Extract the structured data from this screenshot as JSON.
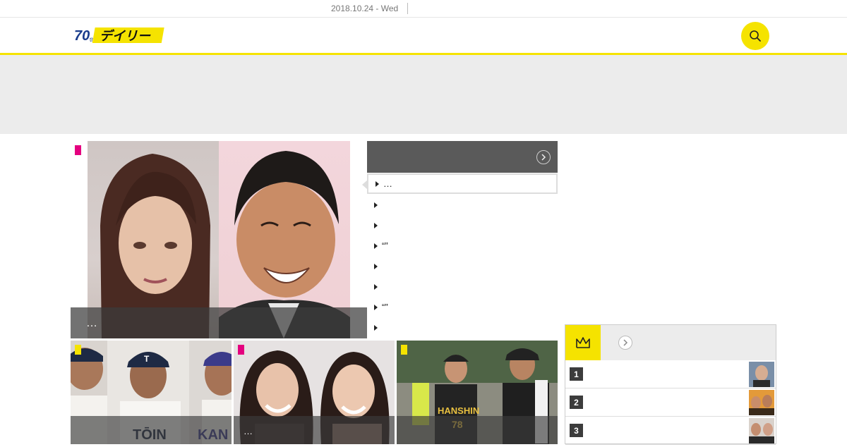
{
  "header": {
    "date": "2018.10.24 - Wed",
    "logo_text": "デイリー",
    "colors": {
      "accent": "#f5e300",
      "tag_entertainment": "#e4007f",
      "tag_sports": "#f5e300",
      "dark": "#5a5a5a"
    }
  },
  "hero": {
    "caption": "…",
    "tag_color": "#e4007f"
  },
  "news_list": {
    "heading": "",
    "items": [
      {
        "label": "…"
      },
      {
        "label": ""
      },
      {
        "label": ""
      },
      {
        "label": "“”"
      },
      {
        "label": ""
      },
      {
        "label": ""
      },
      {
        "label": "“”"
      },
      {
        "label": ""
      }
    ]
  },
  "thumbnails": [
    {
      "caption": "",
      "tag_color": "#f5e300"
    },
    {
      "caption": "…",
      "tag_color": "#e4007f"
    },
    {
      "caption": "",
      "tag_color": "#f5e300"
    }
  ],
  "ranking": {
    "heading": "",
    "items": [
      {
        "rank": "1"
      },
      {
        "rank": "2"
      },
      {
        "rank": "3"
      }
    ]
  },
  "icons": {
    "search": "search-icon",
    "crown": "crown-icon",
    "arrow": "chevron-right-icon"
  }
}
